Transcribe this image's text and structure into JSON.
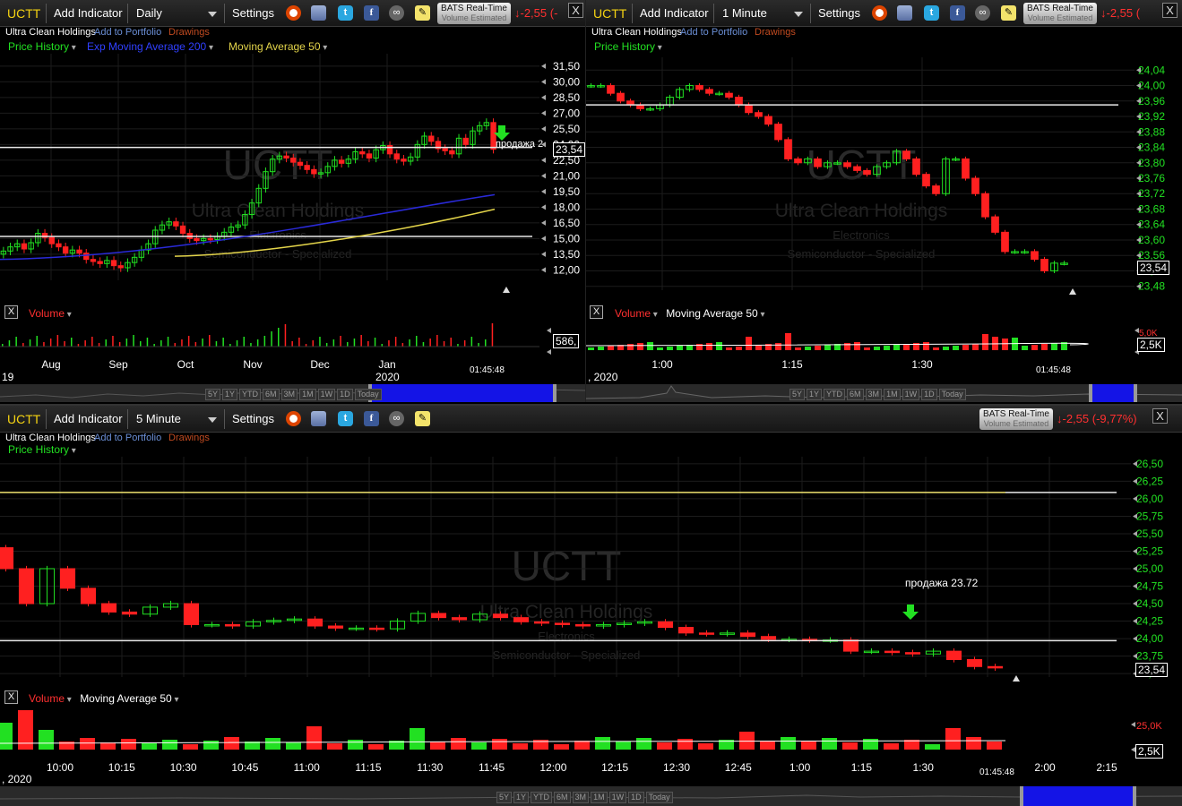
{
  "common": {
    "symbol": "UCTT",
    "add_indicator": "Add Indicator",
    "settings": "Settings",
    "company": "Ultra Clean Holdings",
    "add_portfolio": "Add to Portfolio",
    "drawings": "Drawings",
    "bats_title": "BATS Real-Time",
    "bats_sub": "Volume Estimated",
    "close": "X",
    "price_history": "Price History",
    "volume": "Volume",
    "moving_average_50": "Moving Average 50",
    "watermark_sector": "Electronics",
    "watermark_industry": "Semiconductor - Specialized",
    "last_price": "23,54",
    "range_buttons": [
      "5Y",
      "1Y",
      "YTD",
      "6M",
      "3M",
      "1M",
      "1W",
      "1D",
      "Today"
    ],
    "clock": "01:45:48",
    "colors": {
      "up": "#22e022",
      "down": "#ff2020",
      "symbol": "#f5d312",
      "hline": "#e8e8e8",
      "ema": "#2a2ad8",
      "ma": "#e3d44a"
    }
  },
  "panel1": {
    "interval": "Daily",
    "change": "-2,55 (-",
    "legend_ema": "Exp Moving Average 200",
    "legend_ma": "Moving Average 50",
    "annotation": "продажа 2",
    "volume_tag": "586,",
    "year_left": "19",
    "year_right": "2020"
  },
  "panel2": {
    "interval": "1 Minute",
    "change": "-2,55 (",
    "vol_scale_top": "5,0K",
    "vol_tag": "2,5K",
    "date_label": ", 2020"
  },
  "panel3": {
    "interval": "5 Minute",
    "change": "-2,55 (-9,77%)",
    "annotation": "продажа 23.72",
    "vol_scale_top": "25,0K",
    "vol_tag": "2,5K",
    "date_label": ", 2020"
  },
  "chart_data": [
    {
      "type": "candlestick",
      "title": "UCTT Daily",
      "x_ticks": [
        "Aug",
        "Sep",
        "Oct",
        "Nov",
        "Dec",
        "Jan"
      ],
      "y_ticks": [
        "31,50",
        "30,00",
        "28,50",
        "27,00",
        "25,50",
        "24,00",
        "22,50",
        "21,00",
        "19,50",
        "18,00",
        "16,50",
        "15,00",
        "13,50",
        "12,00"
      ],
      "ylim": [
        11,
        32
      ],
      "horizontal_lines": [
        23.72,
        15.2
      ],
      "series": [
        {
          "name": "Price History",
          "close": [
            13.8,
            14.2,
            14.5,
            14.0,
            14.6,
            15.5,
            15.1,
            14.5,
            14.2,
            13.6,
            13.9,
            13.6,
            13.0,
            12.8,
            12.6,
            12.9,
            12.4,
            12.2,
            12.7,
            13.2,
            13.9,
            14.5,
            15.8,
            16.3,
            16.6,
            16.2,
            15.5,
            15.0,
            14.8,
            15.0,
            14.9,
            15.2,
            15.6,
            16.1,
            16.3,
            17.3,
            18.4,
            19.8,
            21.4,
            22.6,
            22.9,
            22.7,
            22.3,
            22.0,
            21.6,
            21.2,
            21.3,
            21.9,
            22.5,
            22.2,
            22.6,
            23.3,
            23.1,
            22.7,
            23.5,
            23.9,
            23.1,
            22.6,
            22.4,
            22.8,
            24.0,
            24.8,
            24.3,
            23.6,
            23.4,
            23.1,
            24.6,
            24.0,
            25.3,
            25.8,
            26.1,
            23.54
          ]
        },
        {
          "name": "Exp Moving Average 200",
          "start": 13.0,
          "end": 19.2
        },
        {
          "name": "Moving Average 50",
          "start": 13.3,
          "end": 17.8
        }
      ]
    },
    {
      "type": "candlestick",
      "title": "UCTT 1 Minute",
      "x_ticks": [
        "1:00",
        "1:15",
        "1:30"
      ],
      "y_ticks": [
        "24,04",
        "24,00",
        "23,96",
        "23,92",
        "23,88",
        "23,84",
        "23,80",
        "23,76",
        "23,72",
        "23,68",
        "23,64",
        "23,60",
        "23,56",
        "23,52",
        "23,48"
      ],
      "ylim": [
        23.47,
        24.05
      ],
      "horizontal_lines": [
        23.95
      ],
      "series": [
        {
          "name": "Price History",
          "close": [
            24.0,
            24.0,
            23.98,
            23.96,
            23.95,
            23.94,
            23.94,
            23.95,
            23.97,
            23.99,
            24.0,
            23.99,
            23.98,
            23.98,
            23.97,
            23.95,
            23.93,
            23.92,
            23.9,
            23.86,
            23.81,
            23.8,
            23.81,
            23.79,
            23.8,
            23.8,
            23.79,
            23.78,
            23.77,
            23.79,
            23.8,
            23.83,
            23.81,
            23.77,
            23.74,
            23.72,
            23.81,
            23.81,
            23.76,
            23.72,
            23.66,
            23.62,
            23.57,
            23.57,
            23.57,
            23.55,
            23.52,
            23.54,
            23.54
          ]
        }
      ]
    },
    {
      "type": "candlestick",
      "title": "UCTT 5 Minute",
      "x_ticks": [
        "10:00",
        "10:15",
        "10:30",
        "10:45",
        "11:00",
        "11:15",
        "11:30",
        "11:45",
        "12:00",
        "12:15",
        "12:30",
        "12:45",
        "1:00",
        "1:15",
        "1:30",
        "2:00",
        "2:15"
      ],
      "y_ticks": [
        "26,50",
        "26,25",
        "26,00",
        "25,75",
        "25,50",
        "25,25",
        "25,00",
        "24,75",
        "24,50",
        "24,25",
        "24,00",
        "23,75",
        "23,50"
      ],
      "ylim": [
        23.45,
        26.55
      ],
      "horizontal_lines": [
        26.09,
        23.97
      ],
      "series": [
        {
          "name": "Price History",
          "close": [
            25.0,
            24.5,
            25.0,
            24.72,
            24.5,
            24.38,
            24.35,
            24.45,
            24.5,
            24.2,
            24.2,
            24.18,
            24.24,
            24.26,
            24.28,
            24.18,
            24.15,
            24.15,
            24.14,
            24.25,
            24.36,
            24.3,
            24.27,
            24.35,
            24.3,
            24.24,
            24.22,
            24.2,
            24.18,
            24.2,
            24.22,
            24.24,
            24.16,
            24.08,
            24.07,
            24.08,
            24.03,
            23.99,
            23.99,
            23.98,
            23.98,
            23.82,
            23.82,
            23.8,
            23.78,
            23.82,
            23.7,
            23.6,
            23.58
          ]
        },
        {
          "name": "Moving Average 50",
          "value": 26.09
        }
      ]
    }
  ]
}
